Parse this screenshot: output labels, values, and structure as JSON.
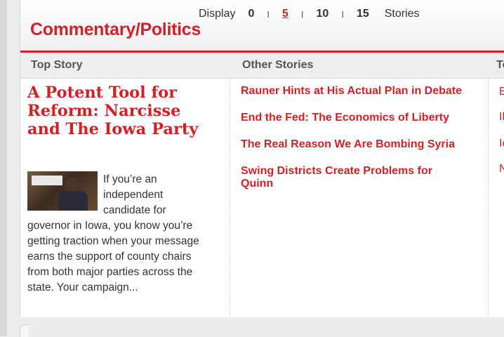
{
  "section": {
    "title": "Commentary/Politics"
  },
  "display": {
    "label": "Display",
    "options": [
      "0",
      "5",
      "10",
      "15"
    ],
    "selected": "5",
    "suffix": "Stories"
  },
  "columns": {
    "top_story": "Top Story",
    "other_stories": "Other Stories",
    "third": "To"
  },
  "top_story": {
    "headline": "A Potent Tool for Reform: Narcisse and The Iowa Party",
    "summary": "If you’re an independent candidate for governor in Iowa, you know you’re getting traction when your message earns the support of county chairs from both major parties across the state. Your campaign..."
  },
  "other_stories": [
    "Rauner Hints at His Actual Plan in Debate",
    "End the Fed: The Economics of Liberty",
    "The Real Reason We Are Bombing Syria",
    "Swing Districts Create Problems for Quinn"
  ],
  "third_column": [
    "E",
    "Il",
    "Io",
    "N"
  ],
  "colors": {
    "accent": "#d31f26"
  }
}
